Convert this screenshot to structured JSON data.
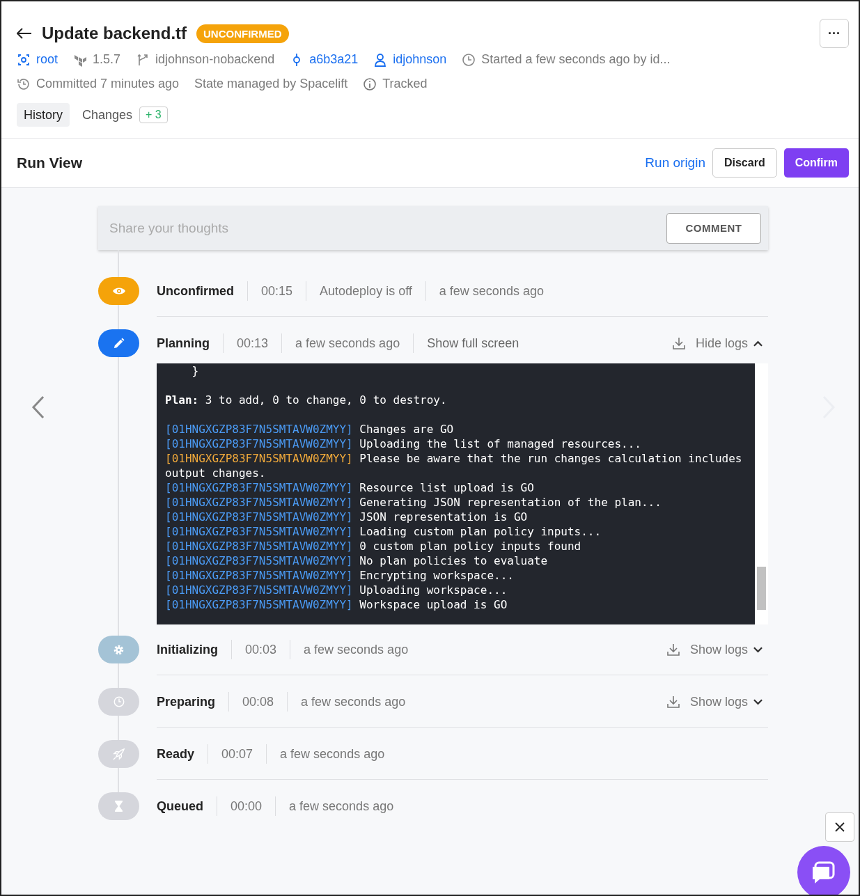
{
  "header": {
    "title": "Update backend.tf",
    "badge": "UNCONFIRMED",
    "more_label": "···",
    "meta_rows": [
      [
        {
          "kind": "stack",
          "text": "root",
          "link": true
        },
        {
          "kind": "terraform",
          "text": "1.5.7",
          "link": false
        },
        {
          "kind": "branch",
          "text": "idjohnson-nobackend",
          "link": false
        },
        {
          "kind": "commit",
          "text": "a6b3a21",
          "link": true
        },
        {
          "kind": "user",
          "text": "idjohnson",
          "link": true
        },
        {
          "kind": "clock",
          "text": "Started a few seconds ago by id...",
          "link": false
        }
      ],
      [
        {
          "kind": "history",
          "text": "Committed 7 minutes ago",
          "link": false
        },
        {
          "kind": "plain",
          "text": "State managed by Spacelift",
          "link": false
        },
        {
          "kind": "info",
          "text": "Tracked",
          "link": false
        }
      ]
    ],
    "tabs": [
      {
        "label": "History",
        "selected": true
      },
      {
        "label": "Changes",
        "count": "+ 3",
        "selected": false
      }
    ]
  },
  "run_view": {
    "title": "Run View",
    "run_origin": "Run origin",
    "discard": "Discard",
    "confirm": "Confirm"
  },
  "comment": {
    "placeholder": "Share your thoughts",
    "button": "COMMENT"
  },
  "stages": [
    {
      "name": "Unconfirmed",
      "kind": "eye",
      "color": "#f5a30a",
      "fields": [
        {
          "text": "00:15",
          "kind": "text"
        },
        {
          "text": "Autodeploy is off",
          "kind": "text"
        },
        {
          "text": "a few seconds ago",
          "kind": "text"
        }
      ]
    },
    {
      "name": "Planning",
      "kind": "pencil",
      "color": "#1a73f0",
      "fields": [
        {
          "text": "00:13",
          "kind": "text"
        },
        {
          "text": "a few seconds ago",
          "kind": "text"
        },
        {
          "text": "Show full screen",
          "kind": "action"
        }
      ],
      "logs": {
        "label": "Hide logs",
        "expanded": true
      }
    },
    {
      "name": "Initializing",
      "kind": "gear",
      "color": "#a4c3d6",
      "fields": [
        {
          "text": "00:03",
          "kind": "text"
        },
        {
          "text": "a few seconds ago",
          "kind": "text"
        }
      ],
      "logs": {
        "label": "Show logs",
        "expanded": false
      }
    },
    {
      "name": "Preparing",
      "kind": "clock",
      "color": "#d5d6dc",
      "fields": [
        {
          "text": "00:08",
          "kind": "text"
        },
        {
          "text": "a few seconds ago",
          "kind": "text"
        }
      ],
      "logs": {
        "label": "Show logs",
        "expanded": false
      }
    },
    {
      "name": "Ready",
      "kind": "rocket",
      "color": "#d5d6dc",
      "fields": [
        {
          "text": "00:07",
          "kind": "text"
        },
        {
          "text": "a few seconds ago",
          "kind": "text"
        }
      ]
    },
    {
      "name": "Queued",
      "kind": "hourglass",
      "color": "#d5d6dc",
      "fields": [
        {
          "text": "00:00",
          "kind": "text"
        },
        {
          "text": "a few seconds ago",
          "kind": "text"
        }
      ]
    }
  ],
  "log_lines": [
    {
      "kind": "plain",
      "text": "    }"
    },
    {
      "kind": "blank"
    },
    {
      "kind": "plan",
      "label": "Plan:",
      "text": " 3 to add, 0 to change, 0 to destroy."
    },
    {
      "kind": "blank"
    },
    {
      "kind": "info",
      "id": "[01HNGXGZP83F7N5SMTAVW0ZMYY]",
      "text": "Changes are GO"
    },
    {
      "kind": "info",
      "id": "[01HNGXGZP83F7N5SMTAVW0ZMYY]",
      "text": "Uploading the list of managed resources..."
    },
    {
      "kind": "warn",
      "id": "[01HNGXGZP83F7N5SMTAVW0ZMYY]",
      "text": "Please be aware that the run changes calculation includes output changes."
    },
    {
      "kind": "info",
      "id": "[01HNGXGZP83F7N5SMTAVW0ZMYY]",
      "text": "Resource list upload is GO"
    },
    {
      "kind": "info",
      "id": "[01HNGXGZP83F7N5SMTAVW0ZMYY]",
      "text": "Generating JSON representation of the plan..."
    },
    {
      "kind": "info",
      "id": "[01HNGXGZP83F7N5SMTAVW0ZMYY]",
      "text": "JSON representation is GO"
    },
    {
      "kind": "info",
      "id": "[01HNGXGZP83F7N5SMTAVW0ZMYY]",
      "text": "Loading custom plan policy inputs..."
    },
    {
      "kind": "info",
      "id": "[01HNGXGZP83F7N5SMTAVW0ZMYY]",
      "text": "0 custom plan policy inputs found"
    },
    {
      "kind": "info",
      "id": "[01HNGXGZP83F7N5SMTAVW0ZMYY]",
      "text": "No plan policies to evaluate"
    },
    {
      "kind": "info",
      "id": "[01HNGXGZP83F7N5SMTAVW0ZMYY]",
      "text": "Encrypting workspace..."
    },
    {
      "kind": "info",
      "id": "[01HNGXGZP83F7N5SMTAVW0ZMYY]",
      "text": "Uploading workspace..."
    },
    {
      "kind": "info",
      "id": "[01HNGXGZP83F7N5SMTAVW0ZMYY]",
      "text": "Workspace upload is GO"
    }
  ]
}
